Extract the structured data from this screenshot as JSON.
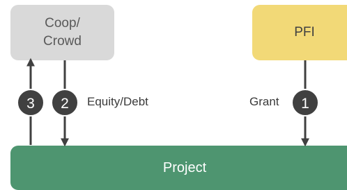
{
  "nodes": {
    "coop": {
      "label": "Coop/\nCrowd",
      "color": "#d9d9d9"
    },
    "pfi": {
      "label": "PFI",
      "color": "#f2d977"
    },
    "project": {
      "label": "Project",
      "color": "#4e9570"
    }
  },
  "flows": {
    "equity_debt": {
      "label": "Equity/Debt",
      "step": "2"
    },
    "grant": {
      "label": "Grant",
      "step": "1"
    },
    "return": {
      "step": "3"
    }
  },
  "colors": {
    "arrow": "#404040",
    "badge": "#404040"
  }
}
